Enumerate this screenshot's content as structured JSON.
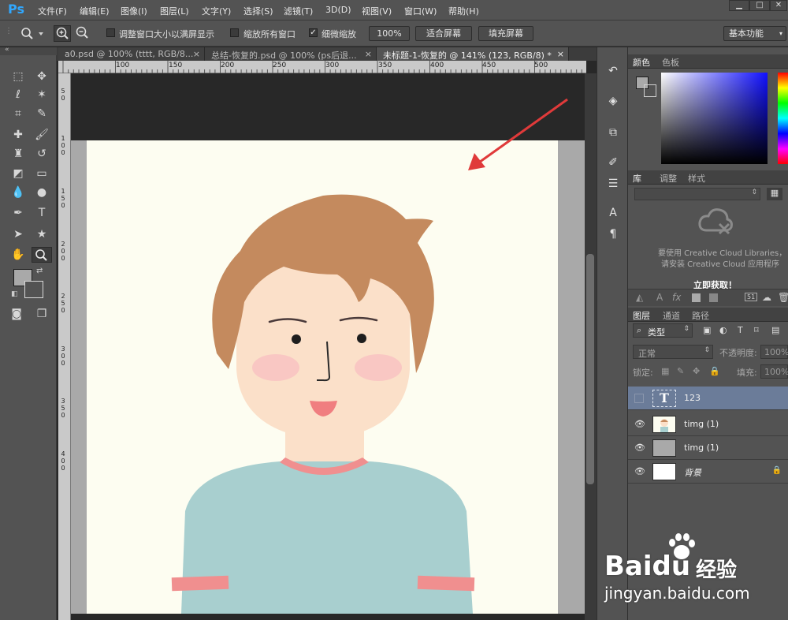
{
  "app": {
    "logo": "Ps",
    "menu": [
      "文件(F)",
      "编辑(E)",
      "图像(I)",
      "图层(L)",
      "文字(Y)",
      "选择(S)",
      "滤镜(T)",
      "3D(D)",
      "视图(V)",
      "窗口(W)",
      "帮助(H)"
    ]
  },
  "window_controls": {
    "minimize": "▁",
    "maximize": "□",
    "close": "✕"
  },
  "options_bar": {
    "resize_windows_label": "调整窗口大小以满屏显示",
    "zoom_all_label": "缩放所有窗口",
    "scrubby_zoom_label": "细微缩放",
    "zoom_value": "100%",
    "fit_screen": "适合屏幕",
    "fill_screen": "填充屏幕",
    "workspace": "基本功能"
  },
  "tabs": [
    {
      "label": "a0.psd @ 100% (tttt, RGB/8...",
      "close": "×"
    },
    {
      "label": "总结-恢复的.psd @ 100% (ps后退...",
      "close": "×"
    },
    {
      "label": "未标题-1-恢复的 @ 141% (123, RGB/8) *",
      "close": "×"
    }
  ],
  "ruler_top": [
    "100",
    "150",
    "200",
    "250",
    "300",
    "350",
    "400",
    "450",
    "500"
  ],
  "ruler_left": [
    "5 0",
    "1 0 0",
    "1 5 0",
    "2 0 0",
    "2 5 0",
    "3 0 0",
    "3 5 0",
    "4 0 0"
  ],
  "panels": {
    "color_tabs": [
      "颜色",
      "色板"
    ],
    "library_tabs": [
      "库",
      "调整",
      "样式"
    ],
    "cc_message_line1": "要使用 Creative Cloud Libraries，",
    "cc_message_line2": "请安装 Creative Cloud 应用程序",
    "cc_action": "立即获取！",
    "layers_tabs": [
      "图层",
      "通道",
      "路径"
    ],
    "filter_kind": "类型",
    "blend_mode": "正常",
    "opacity_label": "不透明度:",
    "opacity_value": "100%",
    "lock_label": "锁定:",
    "fill_label": "填充:",
    "fill_value": "100%",
    "lib_bottom_count": "51",
    "layers": [
      {
        "name": "123",
        "type": "text",
        "visible": false,
        "selected": true
      },
      {
        "name": "timg (1)",
        "type": "image",
        "visible": true,
        "selected": false
      },
      {
        "name": "timg (1)",
        "type": "gray",
        "visible": true,
        "selected": false
      },
      {
        "name": "背景",
        "type": "background",
        "visible": true,
        "selected": false,
        "locked": true
      }
    ]
  },
  "watermark": {
    "brand": "Baidu",
    "brand_cn": "经验",
    "url": "jingyan.baidu.com"
  },
  "colors": {
    "accent": "#31a8ff",
    "arrow": "#e03a3a",
    "canvas_bg": "#fdfdf1",
    "hair": "#c48a5e",
    "shirt": "#a8cfcf",
    "skin": "#fbe0c9"
  }
}
